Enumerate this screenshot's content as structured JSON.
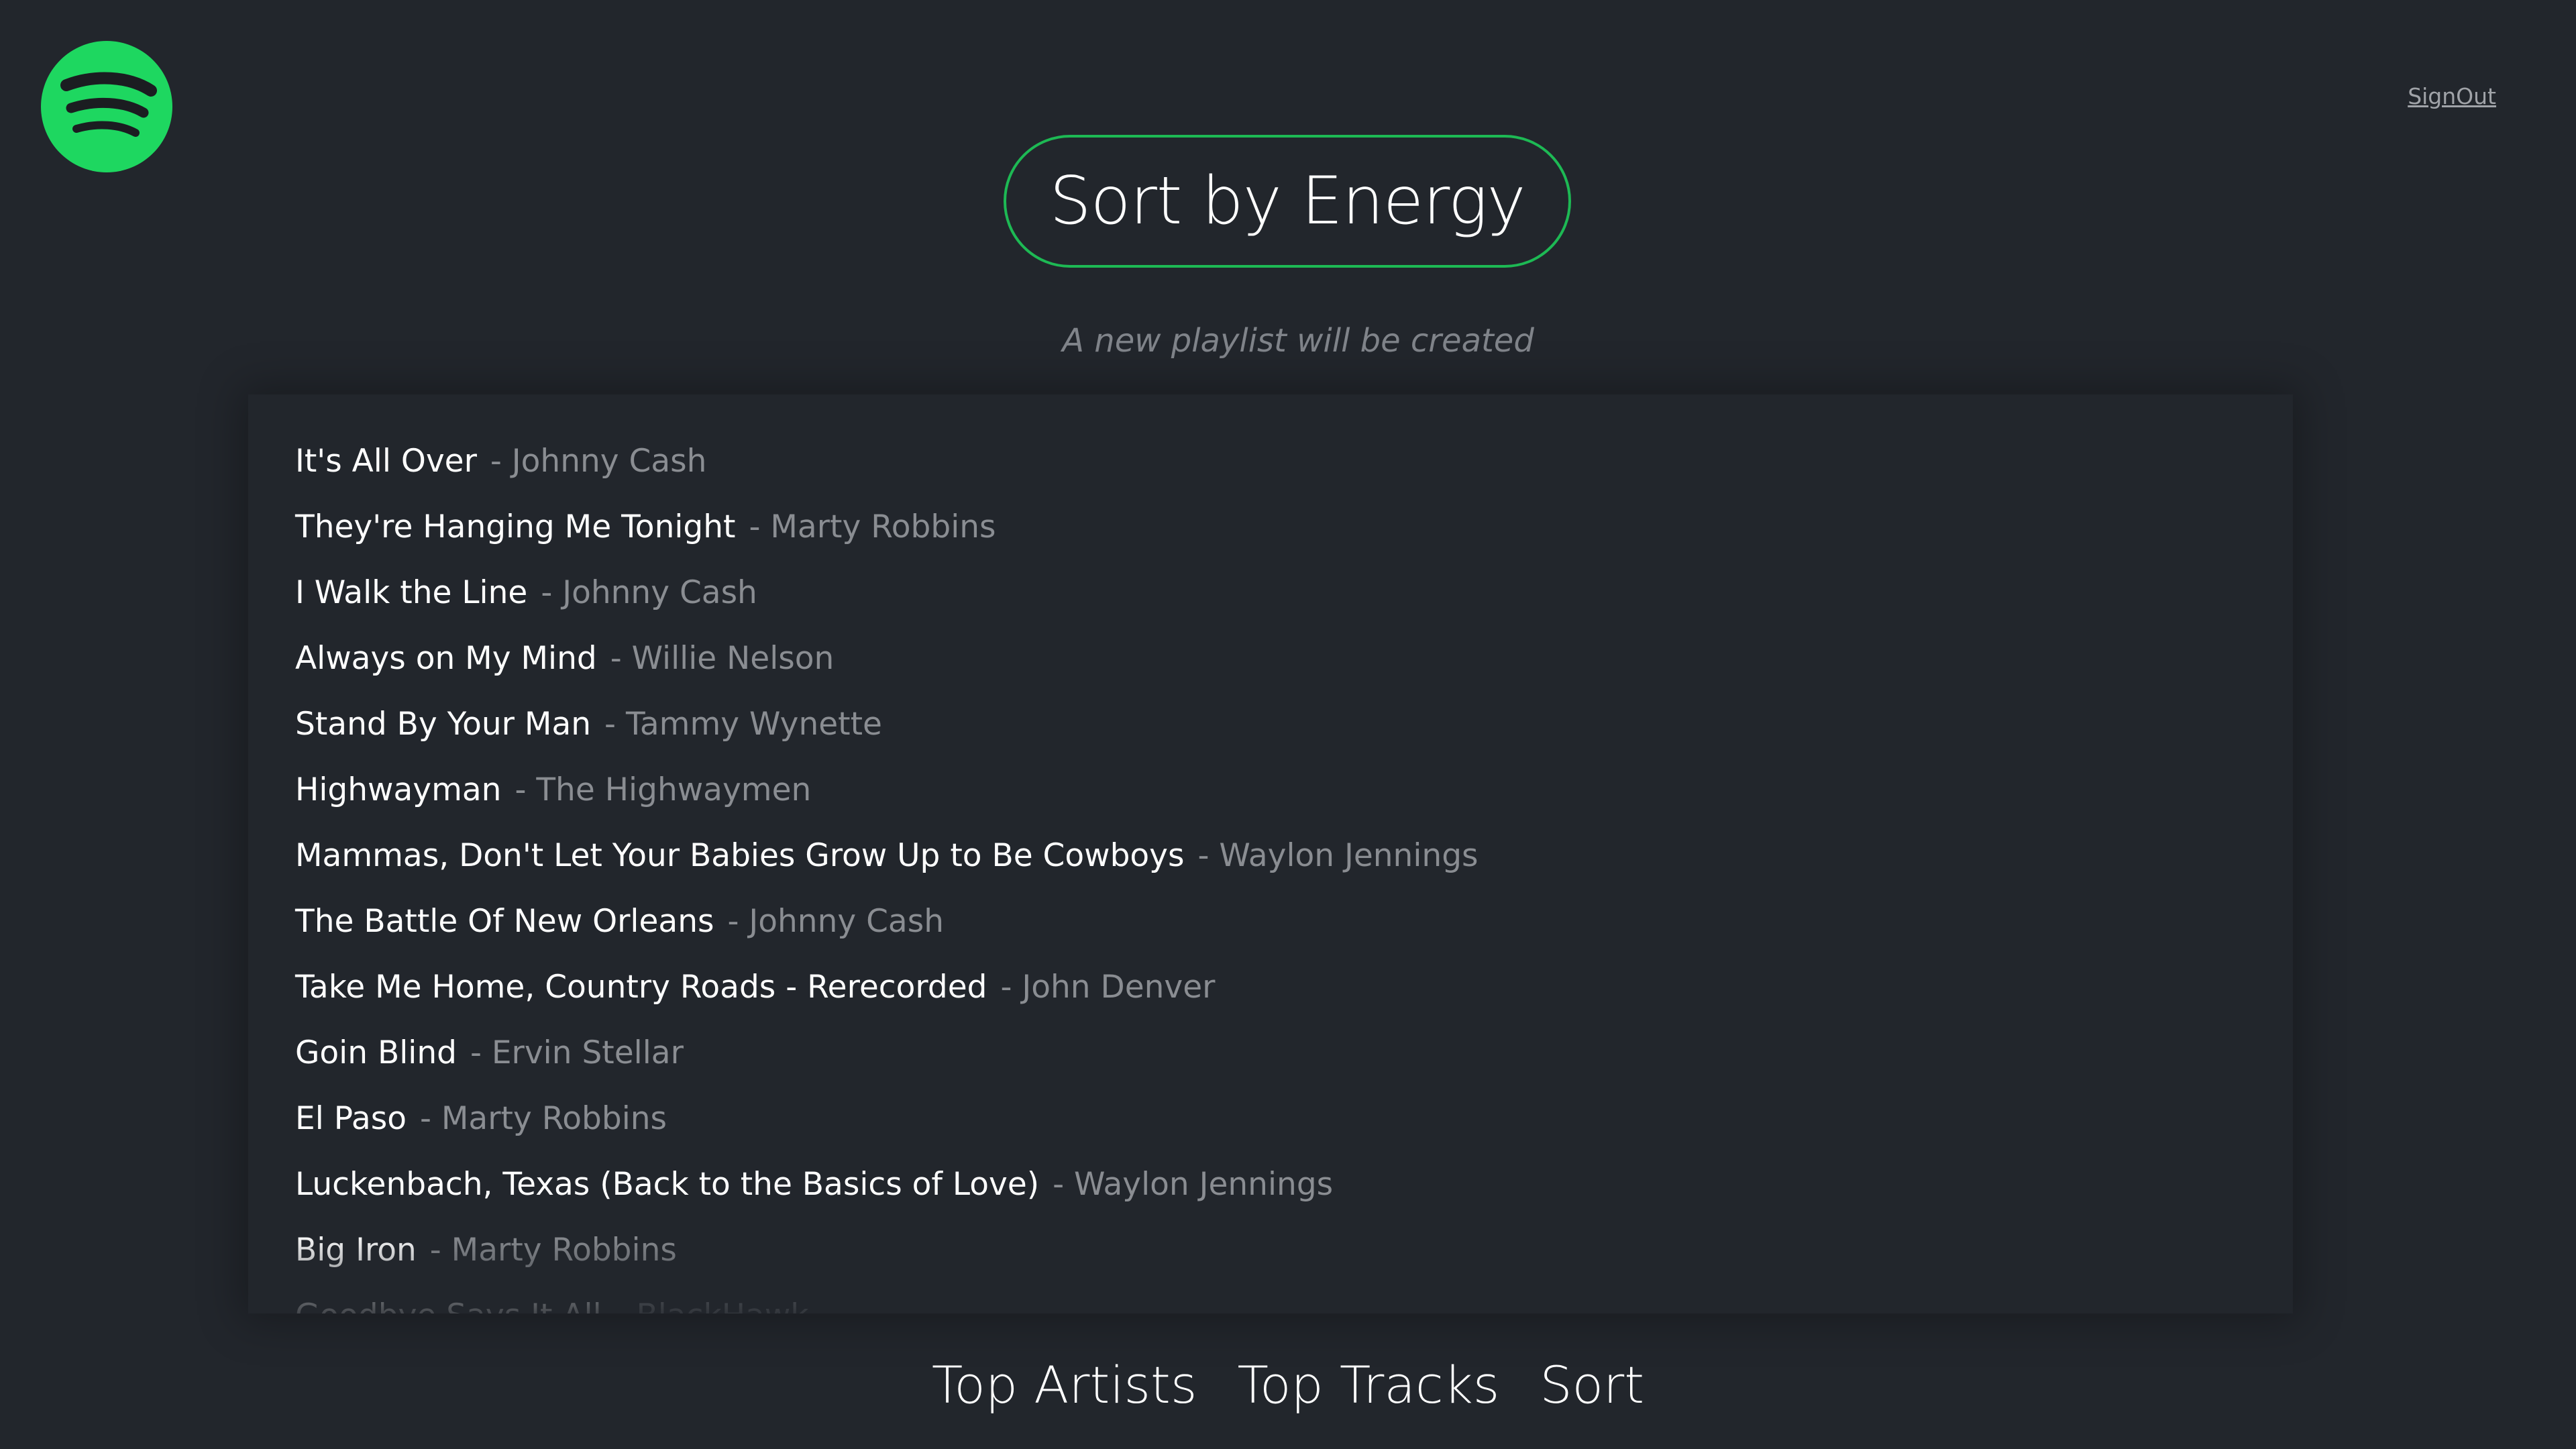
{
  "header": {
    "logo_icon": "spotify-logo-icon",
    "signout_label": "SignOut"
  },
  "main": {
    "sort_button_label": "Sort by Energy",
    "subtitle": "A new playlist will be created"
  },
  "tracks": [
    {
      "name": "It's All Over",
      "artist": "- Johnny Cash"
    },
    {
      "name": "They're Hanging Me Tonight",
      "artist": "- Marty Robbins"
    },
    {
      "name": "I Walk the Line",
      "artist": "- Johnny Cash"
    },
    {
      "name": "Always on My Mind",
      "artist": "- Willie Nelson"
    },
    {
      "name": "Stand By Your Man",
      "artist": "- Tammy Wynette"
    },
    {
      "name": "Highwayman",
      "artist": "- The Highwaymen"
    },
    {
      "name": "Mammas, Don't Let Your Babies Grow Up to Be Cowboys",
      "artist": "- Waylon Jennings"
    },
    {
      "name": "The Battle Of New Orleans",
      "artist": "- Johnny Cash"
    },
    {
      "name": "Take Me Home, Country Roads - Rerecorded",
      "artist": "- John Denver"
    },
    {
      "name": "Goin Blind",
      "artist": "- Ervin Stellar"
    },
    {
      "name": "El Paso",
      "artist": "- Marty Robbins"
    },
    {
      "name": "Luckenbach, Texas (Back to the Basics of Love)",
      "artist": "- Waylon Jennings"
    },
    {
      "name": "Big Iron",
      "artist": "- Marty Robbins"
    },
    {
      "name": "Goodbye Says It All",
      "artist": "- BlackHawk"
    }
  ],
  "nav": {
    "top_artists": "Top Artists",
    "top_tracks": "Top Tracks",
    "sort": "Sort"
  },
  "colors": {
    "background": "#22262c",
    "accent": "#1db954",
    "text_primary": "#ffffff",
    "text_secondary": "#8a8d92"
  }
}
